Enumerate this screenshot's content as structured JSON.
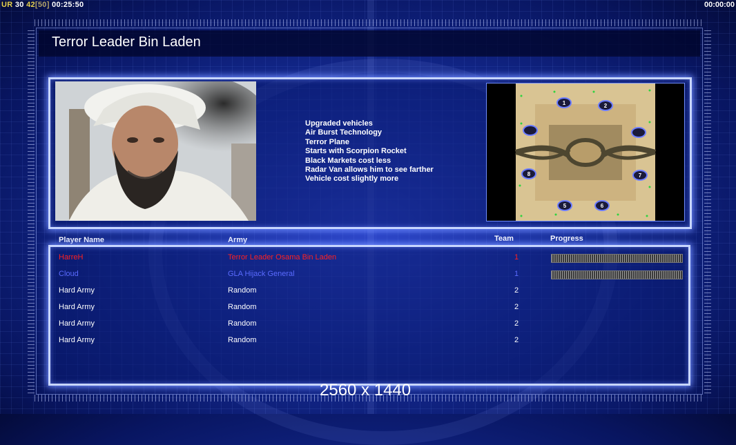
{
  "hud": {
    "top_left": {
      "a": "UR",
      "b": "30",
      "c": "42",
      "d": "[50]",
      "e": "00:25:50"
    },
    "top_right": "00:00:00"
  },
  "title": "Terror Leader Bin Laden",
  "general_traits": [
    "Upgraded vehicles",
    "Air Burst Technology",
    "Terror Plane",
    "Starts with Scorpion Rocket",
    "Black Markets cost less",
    "Radar Van allows him to see farther",
    "Vehicle cost slightly more"
  ],
  "map": {
    "start_positions": [
      "1",
      "2",
      "",
      "",
      "8",
      "7",
      "5",
      "6"
    ]
  },
  "table": {
    "headers": {
      "player": "Player Name",
      "army": "Army",
      "team": "Team",
      "progress": "Progress"
    },
    "rows": [
      {
        "name": "HarreH",
        "army": "Terror Leader Osama Bin Laden",
        "team": "1",
        "color": "#ff2020",
        "progress": 1.0
      },
      {
        "name": "Cloud",
        "army": "GLA Hijack General",
        "team": "1",
        "color": "#5a6bff",
        "progress": 1.0
      },
      {
        "name": "Hard Army",
        "army": "Random",
        "team": "2",
        "color": "#ffffff"
      },
      {
        "name": "Hard Army",
        "army": "Random",
        "team": "2",
        "color": "#ffffff"
      },
      {
        "name": "Hard Army",
        "army": "Random",
        "team": "2",
        "color": "#ffffff"
      },
      {
        "name": "Hard Army",
        "army": "Random",
        "team": "2",
        "color": "#ffffff"
      }
    ]
  },
  "resolution_label": "2560 x 1440"
}
